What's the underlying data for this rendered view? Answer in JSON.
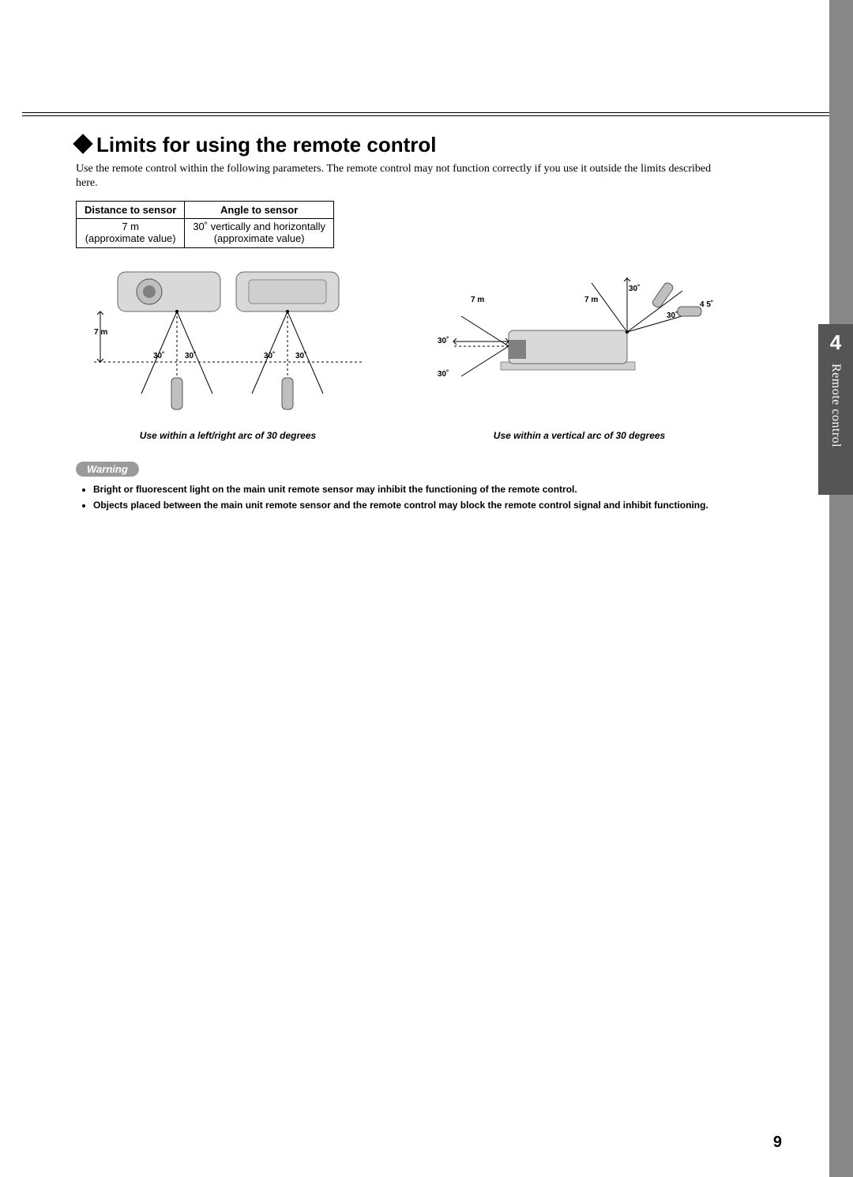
{
  "chapter": {
    "number": "4",
    "label": "Remote control"
  },
  "title": "Limits for using the remote control",
  "intro": "Use the remote control within the following parameters. The remote control may not function correctly if you use it outside the limits described here.",
  "spec_table": {
    "headers": [
      "Distance to sensor",
      "Angle to sensor"
    ],
    "rows": [
      [
        "7 m",
        "30˚ vertically and horizontally"
      ],
      [
        "(approximate value)",
        "(approximate value)"
      ]
    ]
  },
  "diagrams": {
    "left": {
      "caption": "Use within a  left/right arc of 30 degrees",
      "labels": {
        "dist": "7 m",
        "ang": "30˚"
      }
    },
    "right": {
      "caption": "Use within a vertical arc of 30 degrees",
      "labels": {
        "dist": "7 m",
        "ang": "30˚",
        "extra": "4 5˚"
      }
    }
  },
  "warning": {
    "label": "Warning",
    "items": [
      "Bright or fluorescent light on the main unit remote sensor may inhibit the functioning of the remote control.",
      "Objects placed between the main unit remote sensor and the remote control may block the remote control signal and inhibit functioning."
    ]
  },
  "page_number": "9"
}
